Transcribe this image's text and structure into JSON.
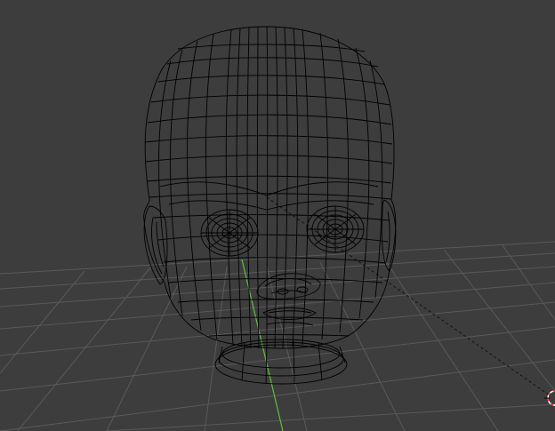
{
  "viewport": {
    "mode": "wireframe",
    "background_color": "#3d3d3d",
    "grid_color": "#5a5a5a",
    "wire_color": "#000000",
    "y_axis_color": "#5fbf3f",
    "object": "baby-head-mesh",
    "object_origin_marker": "dashed-relationship-line",
    "cursor": "3d-cursor-icon"
  }
}
